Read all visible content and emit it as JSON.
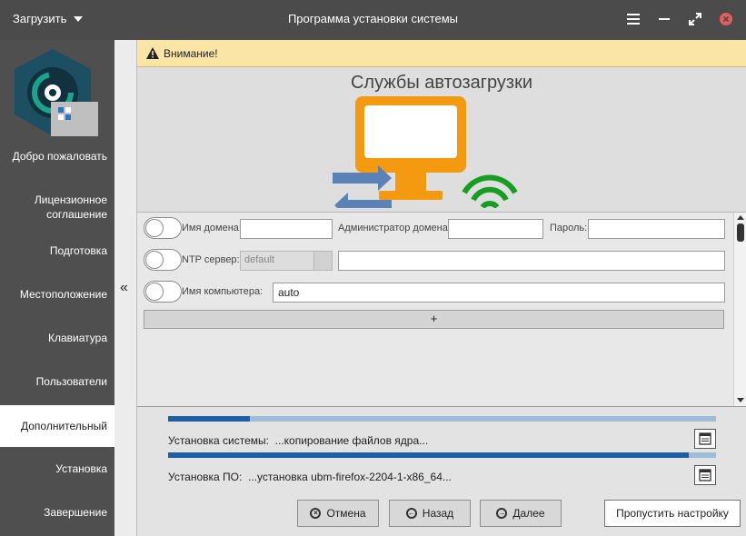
{
  "titlebar": {
    "load_label": "Загрузить",
    "title": "Программа установки системы",
    "icons": [
      "menu-icon",
      "minimize-icon",
      "maximize-icon",
      "close-icon"
    ],
    "close_color": "#e35d5d"
  },
  "sidebar": {
    "items": [
      {
        "label": "Добро пожаловать"
      },
      {
        "label": "Лицензионное соглашение"
      },
      {
        "label": "Подготовка"
      },
      {
        "label": "Местоположение"
      },
      {
        "label": "Клавиатура"
      },
      {
        "label": "Пользователи"
      },
      {
        "label": "Дополнительный"
      },
      {
        "label": "Установка"
      },
      {
        "label": "Завершение"
      }
    ],
    "active_index": 6,
    "collapse_glyph": "«"
  },
  "warning": {
    "text": "Внимание!"
  },
  "hero": {
    "title": "Службы автозагрузки",
    "colors": {
      "monitor": "#f39a10",
      "arrows": "#5b82b6",
      "wifi": "#159e21"
    }
  },
  "form": {
    "domain_label": "Имя домена:",
    "domain_value": "",
    "admin_label": "Администратор домена:",
    "admin_value": "",
    "password_label": "Пароль:",
    "password_value": "",
    "ntp_label": "NTP сервер:",
    "ntp_select_value": "default",
    "ntp_value": "",
    "hostname_label": "Имя компьютера:",
    "hostname_value": "auto",
    "add_label": "+"
  },
  "progress": {
    "system_label": "Установка системы:",
    "system_status": "...копирование файлов ядра...",
    "system_fraction": 0.15,
    "software_label": "Установка ПО:",
    "software_status": "...установка ubm-firefox-2204-1-x86_64...",
    "software_fraction": 0.95,
    "bar_color": "#1f5ea5",
    "bar_bg": "#9fbcd9"
  },
  "buttons": {
    "cancel": "Отмена",
    "back": "Назад",
    "next": "Далее",
    "skip": "Пропустить настройку"
  }
}
